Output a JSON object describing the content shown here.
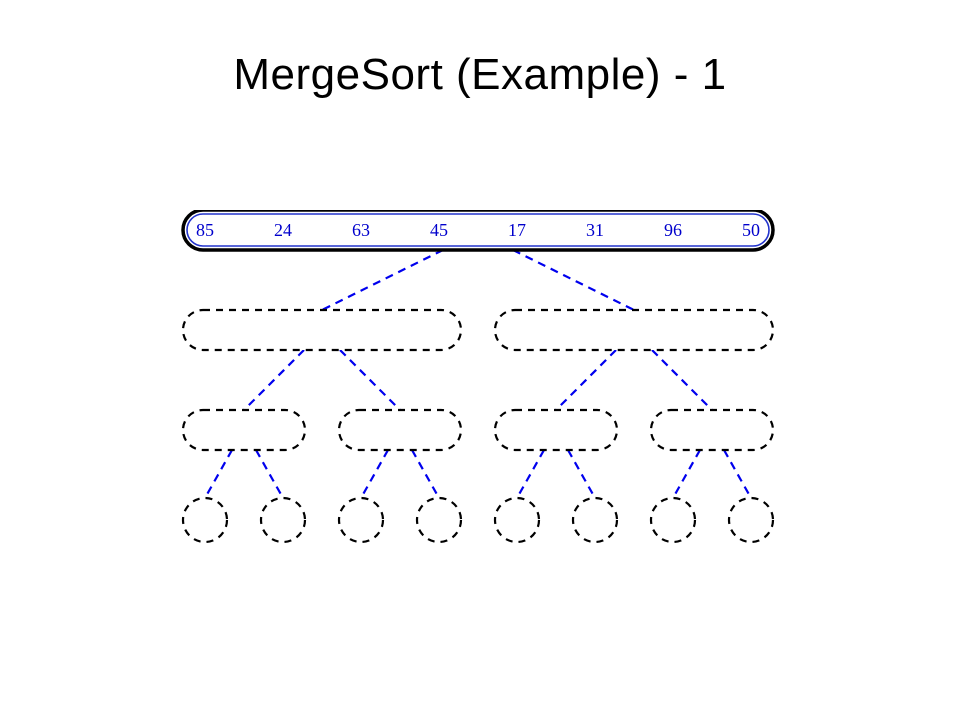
{
  "title": "MergeSort (Example) - 1",
  "values": [
    "85",
    "24",
    "63",
    "45",
    "17",
    "31",
    "96",
    "50"
  ],
  "colors": {
    "text": "#0000cc",
    "connector": "#0000ee",
    "node_border": "#000000",
    "highlight_inner_border": "#2233cc"
  }
}
